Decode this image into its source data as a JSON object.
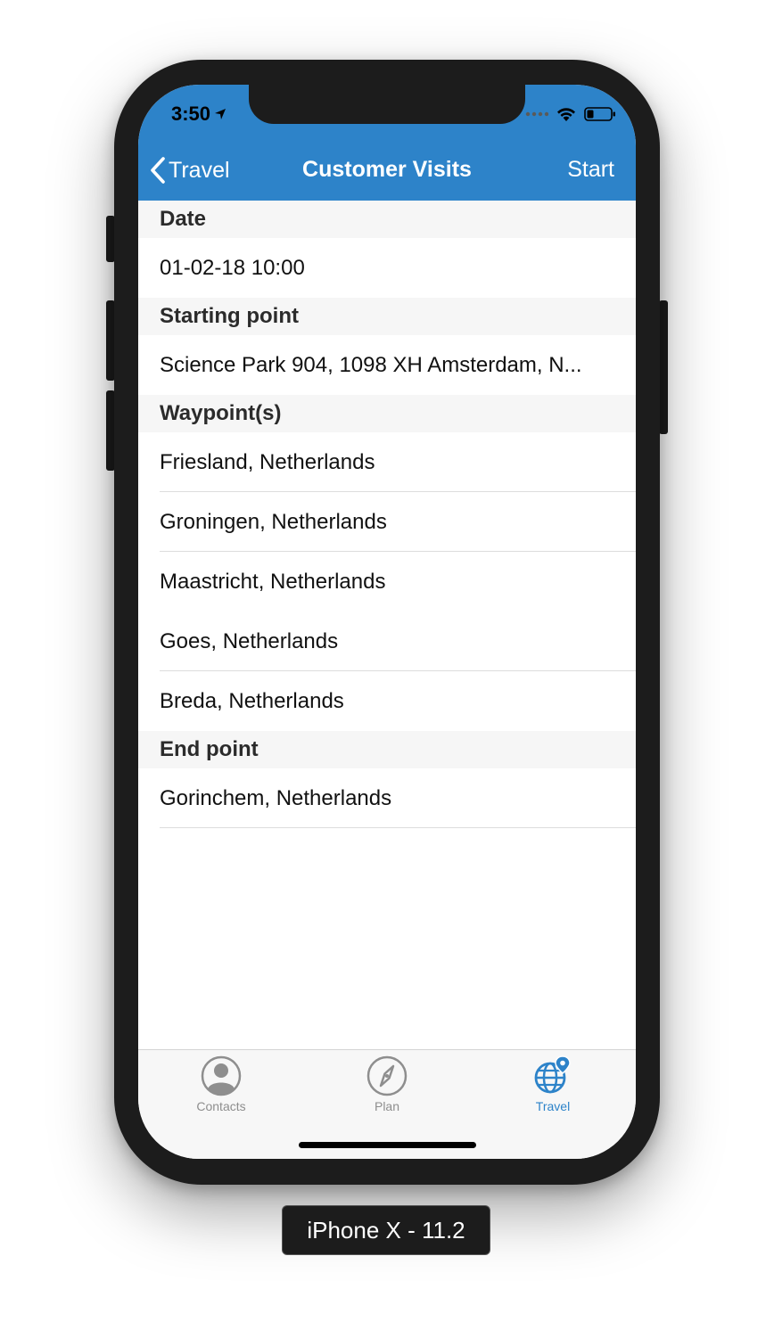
{
  "status_bar": {
    "time": "3:50"
  },
  "navbar": {
    "back_label": "Travel",
    "title": "Customer Visits",
    "action_label": "Start",
    "color": "#2d83c9"
  },
  "sections": {
    "date": {
      "header": "Date",
      "value": "01-02-18 10:00"
    },
    "starting_point": {
      "header": "Starting point",
      "value": "Science Park 904, 1098 XH Amsterdam, N..."
    },
    "waypoints": {
      "header": "Waypoint(s)",
      "items": [
        "Friesland, Netherlands",
        "Groningen, Netherlands",
        "Maastricht, Netherlands",
        "Goes, Netherlands",
        "Breda, Netherlands"
      ]
    },
    "end_point": {
      "header": "End point",
      "value": "Gorinchem, Netherlands"
    }
  },
  "tabbar": {
    "tabs": [
      {
        "label": "Contacts",
        "icon": "person-circle-icon",
        "active": false
      },
      {
        "label": "Plan",
        "icon": "compass-icon",
        "active": false
      },
      {
        "label": "Travel",
        "icon": "globe-pin-icon",
        "active": true
      }
    ],
    "active_color": "#2d83c9",
    "inactive_color": "#8e8e8e"
  },
  "device_label": "iPhone X - 11.2"
}
